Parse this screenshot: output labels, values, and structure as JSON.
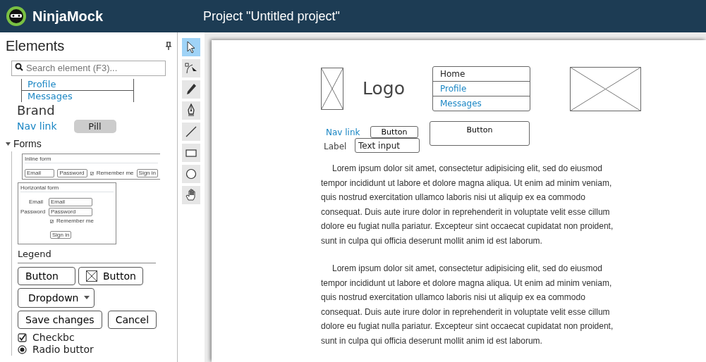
{
  "header": {
    "app_name": "NinjaMock",
    "project_title": "Project \"Untitled project\""
  },
  "sidebar": {
    "title": "Elements",
    "search": {
      "placeholder": "Search element (F3)..."
    },
    "nav_stack": [
      "Profile",
      "Messages"
    ],
    "brand": "Brand",
    "nav_link": "Nav link",
    "pill": "Pill",
    "group": {
      "label": "Forms",
      "expanded": true
    },
    "inline_form": {
      "title": "Inline form",
      "fields": [
        "Email",
        "Password"
      ],
      "checkbox": "Remember me",
      "button": "Sign in"
    },
    "horizontal_form": {
      "title": "Horizontal form",
      "rows": [
        {
          "label": "Email",
          "placeholder": "Email"
        },
        {
          "label": "Password",
          "placeholder": "Password"
        }
      ],
      "checkbox": "Remember me",
      "button": "Sign in"
    },
    "legend": "Legend",
    "buttons": [
      {
        "label": "Button",
        "image": false
      },
      {
        "label": "Button",
        "image": true
      }
    ],
    "dropdown": "Dropdown",
    "form_buttons": [
      "Save changes",
      "Cancel"
    ],
    "checkbox": {
      "label": "Checkbc",
      "checked": true
    },
    "radio": {
      "label": "Radio buttor",
      "selected": true
    }
  },
  "tools": [
    {
      "kind": "select",
      "selected": true
    },
    {
      "kind": "node",
      "selected": false
    },
    {
      "kind": "pencil",
      "selected": false
    },
    {
      "kind": "pen",
      "selected": false
    },
    {
      "kind": "line",
      "selected": false
    },
    {
      "kind": "rectangle",
      "selected": false
    },
    {
      "kind": "ellipse",
      "selected": false
    },
    {
      "kind": "hand",
      "selected": false
    }
  ],
  "canvas": {
    "logo": "Logo",
    "nav_list": [
      {
        "label": "Home",
        "kind": "text"
      },
      {
        "label": "Profile",
        "kind": "link"
      },
      {
        "label": "Messages",
        "kind": "link"
      }
    ],
    "nav_link": "Nav link",
    "small_button": "Button",
    "large_button": "Button",
    "label": "Label",
    "text_input": "Text input",
    "paragraphs": [
      "Lorem ipsum dolor sit amet, consectetur adipisicing elit, sed do eiusmod tempor incididunt ut labore et dolore magna aliqua. Ut enim ad minim veniam, quis nostrud exercitation ullamco laboris nisi ut aliquip ex ea commodo consequat. Duis aute irure dolor in reprehenderit in voluptate velit esse cillum dolore eu fugiat nulla pariatur. Excepteur sint occaecat cupidatat non proident, sunt in culpa qui officia deserunt mollit anim id est laborum.",
      "Lorem ipsum dolor sit amet, consectetur adipisicing elit, sed do eiusmod tempor incididunt ut labore et dolore magna aliqua. Ut enim ad minim veniam, quis nostrud exercitation ullamco laboris nisi ut aliquip ex ea commodo consequat. Duis aute irure dolor in reprehenderit in voluptate velit esse cillum dolore eu fugiat nulla pariatur. Excepteur sint occaecat cupidatat non proident, sunt in culpa qui officia deserunt mollit anim id est laborum."
    ]
  }
}
